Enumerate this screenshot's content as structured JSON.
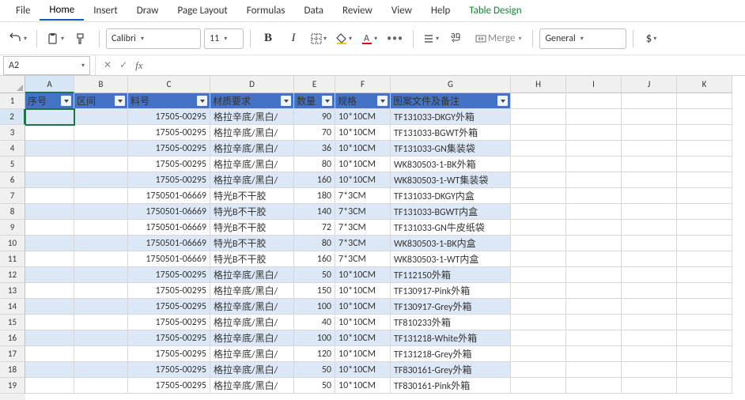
{
  "menu": {
    "file": "File",
    "home": "Home",
    "insert": "Insert",
    "draw": "Draw",
    "page_layout": "Page Layout",
    "formulas": "Formulas",
    "data": "Data",
    "review": "Review",
    "view": "View",
    "help": "Help",
    "table_design": "Table Design"
  },
  "toolbar": {
    "font_name": "Calibri",
    "font_size": "11",
    "merge": "Merge",
    "number_format": "General"
  },
  "namebox": "A2",
  "col_letters": [
    "A",
    "B",
    "C",
    "D",
    "E",
    "F",
    "G",
    "H",
    "I",
    "J",
    "K"
  ],
  "row_numbers": [
    1,
    2,
    3,
    4,
    5,
    6,
    7,
    8,
    9,
    10,
    11,
    12,
    13,
    14,
    15,
    16,
    17,
    18,
    19
  ],
  "table_headers": [
    "序号",
    "区间",
    "料号",
    "材质要求",
    "数量",
    "规格",
    "图案文件及备注"
  ],
  "rows": [
    {
      "c": "17505-00295",
      "d": "格拉辛底/黑白/",
      "e": "90",
      "f": "10*10CM",
      "g": "TF131033-DKGY外箱"
    },
    {
      "c": "17505-00295",
      "d": "格拉辛底/黑白/",
      "e": "70",
      "f": "10*10CM",
      "g": "TF131033-BGWT外箱"
    },
    {
      "c": "17505-00295",
      "d": "格拉辛底/黑白/",
      "e": "36",
      "f": "10*10CM",
      "g": "TF131033-GN集装袋"
    },
    {
      "c": "17505-00295",
      "d": "格拉辛底/黑白/",
      "e": "80",
      "f": "10*10CM",
      "g": "WK830503-1-BK外箱"
    },
    {
      "c": "17505-00295",
      "d": "格拉辛底/黑白/",
      "e": "160",
      "f": "10*10CM",
      "g": "WK830503-1-WT集装袋"
    },
    {
      "c": "1750501-06669",
      "d": "特光B不干胶",
      "e": "180",
      "f": "7*3CM",
      "g": "TF131033-DKGY内盒"
    },
    {
      "c": "1750501-06669",
      "d": "特光B不干胶",
      "e": "140",
      "f": "7*3CM",
      "g": "TF131033-BGWT内盒"
    },
    {
      "c": "1750501-06669",
      "d": "特光B不干胶",
      "e": "72",
      "f": "7*3CM",
      "g": "TF131033-GN牛皮纸袋"
    },
    {
      "c": "1750501-06669",
      "d": "特光B不干胶",
      "e": "80",
      "f": "7*3CM",
      "g": "WK830503-1-BK内盒"
    },
    {
      "c": "1750501-06669",
      "d": "特光B不干胶",
      "e": "160",
      "f": "7*3CM",
      "g": "WK830503-1-WT内盒"
    },
    {
      "c": "17505-00295",
      "d": "格拉辛底/黑白/",
      "e": "50",
      "f": "10*10CM",
      "g": "TF112150外箱"
    },
    {
      "c": "17505-00295",
      "d": "格拉辛底/黑白/",
      "e": "150",
      "f": "10*10CM",
      "g": "TF130917-Pink外箱"
    },
    {
      "c": "17505-00295",
      "d": "格拉辛底/黑白/",
      "e": "100",
      "f": "10*10CM",
      "g": "TF130917-Grey外箱"
    },
    {
      "c": "17505-00295",
      "d": "格拉辛底/黑白/",
      "e": "40",
      "f": "10*10CM",
      "g": "TF810233外箱"
    },
    {
      "c": "17505-00295",
      "d": "格拉辛底/黑白/",
      "e": "100",
      "f": "10*10CM",
      "g": "TF131218-White外箱"
    },
    {
      "c": "17505-00295",
      "d": "格拉辛底/黑白/",
      "e": "120",
      "f": "10*10CM",
      "g": "TF131218-Grey外箱"
    },
    {
      "c": "17505-00295",
      "d": "格拉辛底/黑白/",
      "e": "50",
      "f": "10*10CM",
      "g": "TF830161-Grey外箱"
    },
    {
      "c": "17505-00295",
      "d": "格拉辛底/黑白/",
      "e": "50",
      "f": "10*10CM",
      "g": "TF830161-Pink外箱"
    }
  ]
}
